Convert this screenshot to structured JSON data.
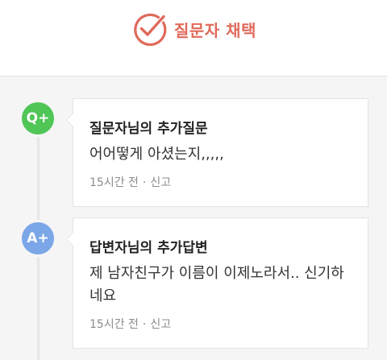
{
  "header": {
    "title": "질문자 채택",
    "icon": "check-circle-icon",
    "accent_color": "#e06a5b"
  },
  "thread": [
    {
      "badge": "Q+",
      "badge_color": "#4fc656",
      "title": "질문자님의 추가질문",
      "body": "어어떻게 아셨는지,,,,,",
      "time": "15시간 전",
      "separator": "·",
      "report": "신고"
    },
    {
      "badge": "A+",
      "badge_color": "#7ba6e8",
      "title": "답변자님의 추가답변",
      "body": "제 남자친구가 이름이 이제노라서.. 신기하네요",
      "time": "15시간 전",
      "separator": "·",
      "report": "신고"
    }
  ]
}
